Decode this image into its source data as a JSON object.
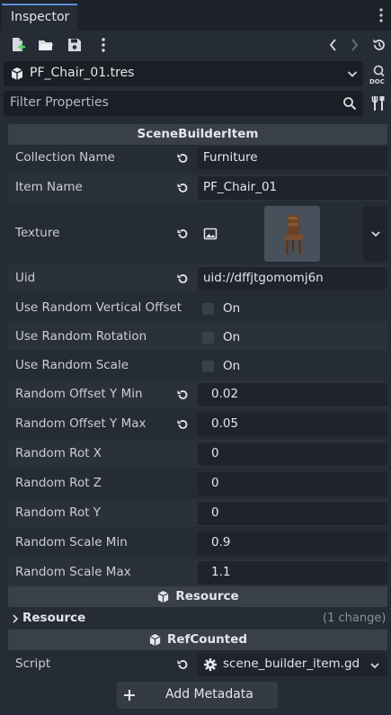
{
  "tab": {
    "title": "Inspector"
  },
  "toolbar": {
    "icons": [
      "new-resource-icon",
      "open-folder-icon",
      "save-icon",
      "more-vertical-icon",
      "history-back-icon",
      "history-forward-icon",
      "object-history-icon"
    ]
  },
  "resource_picker": {
    "name": "PF_Chair_01.tres"
  },
  "filter": {
    "placeholder": "Filter Properties"
  },
  "section_scenebuilder": {
    "title": "SceneBuilderItem"
  },
  "properties": {
    "collection_name": {
      "label": "Collection Name",
      "value": "Furniture"
    },
    "item_name": {
      "label": "Item Name",
      "value": "PF_Chair_01"
    },
    "texture": {
      "label": "Texture"
    },
    "uid": {
      "label": "Uid",
      "value": "uid://dffjtgomomj6n"
    },
    "use_random_vertical_offset": {
      "label": "Use Random Vertical Offset",
      "value": "On",
      "checked": false
    },
    "use_random_rotation": {
      "label": "Use Random Rotation",
      "value": "On",
      "checked": false
    },
    "use_random_scale": {
      "label": "Use Random Scale",
      "value": "On",
      "checked": false
    },
    "random_offset_y_min": {
      "label": "Random Offset Y Min",
      "value": "0.02"
    },
    "random_offset_y_max": {
      "label": "Random Offset Y Max",
      "value": "0.05"
    },
    "random_rot_x": {
      "label": "Random Rot X",
      "value": "0"
    },
    "random_rot_z": {
      "label": "Random Rot Z",
      "value": "0"
    },
    "random_rot_y": {
      "label": "Random Rot Y",
      "value": "0"
    },
    "random_scale_min": {
      "label": "Random Scale Min",
      "value": "0.9"
    },
    "random_scale_max": {
      "label": "Random Scale Max",
      "value": "1.1"
    }
  },
  "section_resource": {
    "title": "Resource"
  },
  "resource_group": {
    "label": "Resource",
    "changes": "(1 change)"
  },
  "section_refcounted": {
    "title": "RefCounted"
  },
  "script": {
    "label": "Script",
    "value": "scene_builder_item.gd"
  },
  "add_metadata": {
    "label": "Add Metadata"
  },
  "colors": {
    "background": "#262c35",
    "field": "#1f242c",
    "section": "#3a404a",
    "accent": "#5f8fd6",
    "text": "#c9ced6"
  }
}
